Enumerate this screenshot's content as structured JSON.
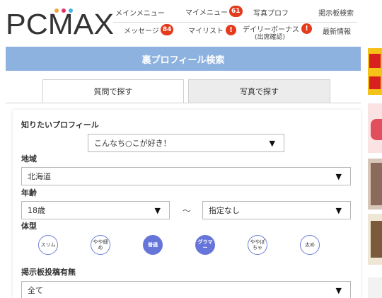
{
  "logo": {
    "text": "PCMAX"
  },
  "nav": {
    "main_menu": "メインメニュー",
    "my_menu": "マイメニュー",
    "my_menu_badge": "61",
    "photo_profile": "写真プロフ",
    "board_search": "掲示板検索",
    "message": "メッセージ",
    "message_badge": "84",
    "my_list": "マイリスト",
    "my_list_alert": "!",
    "daily_bonus": "デイリーボーナス",
    "daily_bonus_sub": "(出席確認)",
    "daily_bonus_alert": "!",
    "latest_info": "最新情報"
  },
  "page_title": "裏プロフィール検索",
  "tabs": [
    {
      "label": "質問で探す",
      "active": true
    },
    {
      "label": "写真で探す",
      "active": false
    }
  ],
  "form": {
    "profile_label": "知りたいプロフィール",
    "profile_value": "こんなち○こが好き！",
    "region_label": "地域",
    "region_value": "北海道",
    "age_label": "年齢",
    "age_min": "18歳",
    "age_separator": "〜",
    "age_max": "指定なし",
    "body_label": "体型",
    "body_types": [
      {
        "label": "スリム",
        "selected": false
      },
      {
        "label": "やや細め",
        "selected": false
      },
      {
        "label": "普通",
        "selected": true
      },
      {
        "label": "グラマー",
        "selected": true
      },
      {
        "label": "ややぽちゃ",
        "selected": false
      },
      {
        "label": "太め",
        "selected": false
      }
    ],
    "board_label": "掲示板投稿有無",
    "board_value": "全て"
  },
  "colors": {
    "title_bar": "#8eb2e0",
    "badge_red": "#e33b1b",
    "body_selected": "#6675d9"
  },
  "icons": {
    "dropdown": "caret-down-icon"
  }
}
